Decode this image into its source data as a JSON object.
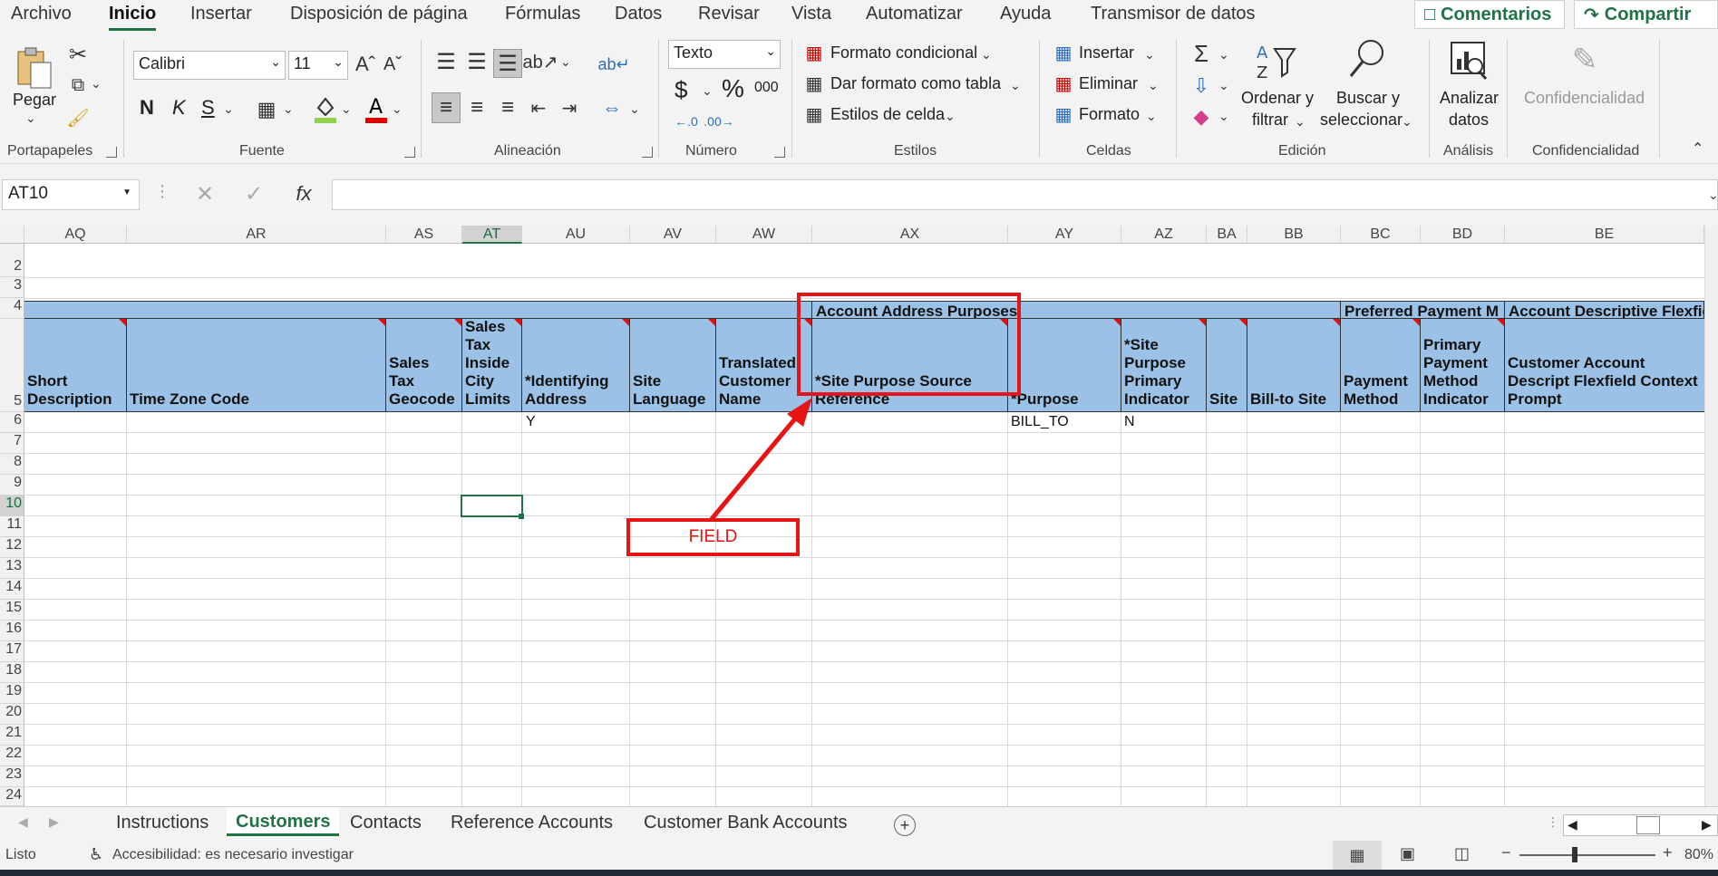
{
  "menu": {
    "tabs": [
      "Archivo",
      "Inicio",
      "Insertar",
      "Disposición de página",
      "Fórmulas",
      "Datos",
      "Revisar",
      "Vista",
      "Automatizar",
      "Ayuda",
      "Transmisor de datos"
    ],
    "active_tab": "Inicio",
    "comments_label": "Comentarios",
    "share_label": "Compartir"
  },
  "ribbon": {
    "clipboard": {
      "paste_label": "Pegar",
      "group_label": "Portapapeles"
    },
    "font": {
      "family": "Calibri",
      "size": "11",
      "bold": "N",
      "italic": "K",
      "underline": "S",
      "group_label": "Fuente"
    },
    "alignment": {
      "group_label": "Alineación"
    },
    "number": {
      "format": "Texto",
      "group_label": "Número",
      "percent": "%",
      "thousands": "000",
      "currency": "$"
    },
    "styles": {
      "conditional": "Formato condicional",
      "as_table": "Dar formato como tabla",
      "cell_styles": "Estilos de celda",
      "group_label": "Estilos"
    },
    "cells": {
      "insert": "Insertar",
      "delete": "Eliminar",
      "format": "Formato",
      "group_label": "Celdas"
    },
    "editing": {
      "sort_filter_1": "Ordenar y",
      "sort_filter_2": "filtrar",
      "find_1": "Buscar y",
      "find_2": "seleccionar",
      "group_label": "Edición"
    },
    "analysis": {
      "analyze_1": "Analizar",
      "analyze_2": "datos",
      "group_label": "Análisis"
    },
    "confidentiality": {
      "button": "Confidencialidad",
      "group_label": "Confidencialidad"
    }
  },
  "formula_bar": {
    "name_box": "AT10",
    "formula": ""
  },
  "grid": {
    "columns": [
      "AQ",
      "AR",
      "AS",
      "AT",
      "AU",
      "AV",
      "AW",
      "AX",
      "AY",
      "AZ",
      "BA",
      "BB",
      "BC",
      "BD",
      "BE"
    ],
    "selected_column": "AT",
    "rows": [
      "2",
      "3",
      "4",
      "5",
      "6",
      "7",
      "8",
      "9",
      "10",
      "11",
      "12",
      "13",
      "14",
      "15",
      "16",
      "17",
      "18",
      "19",
      "20",
      "21",
      "22",
      "23",
      "24"
    ],
    "selected_row": "10",
    "group_headers": [
      "Account Address Purposes",
      "Preferred Payment M",
      "Account Descriptive Flexfie"
    ],
    "headers": [
      "Short Description",
      "Time Zone Code",
      "Sales Tax Geocode",
      "Sales Tax Inside City Limits",
      "*Identifying Address",
      "Site Language",
      "Translated Customer Name",
      "*Site Purpose Source Reference",
      "*Purpose",
      "*Site Purpose Primary Indicator",
      "Site",
      "Bill-to Site",
      "Payment Method",
      "Primary Payment Method Indicator",
      "Customer Account Descript Flexfield Context Prompt"
    ],
    "row6": {
      "identifying_address": "Y",
      "purpose": "BILL_TO",
      "primary_indicator": "N"
    }
  },
  "annotation": {
    "label": "FIELD",
    "color": "#e61414"
  },
  "sheets": {
    "tabs": [
      "Instructions",
      "Customers",
      "Contacts",
      "Reference Accounts",
      "Customer Bank Accounts"
    ],
    "active": "Customers"
  },
  "status": {
    "ready": "Listo",
    "accessibility": "Accesibilidad: es necesario investigar",
    "zoom": "80%"
  }
}
